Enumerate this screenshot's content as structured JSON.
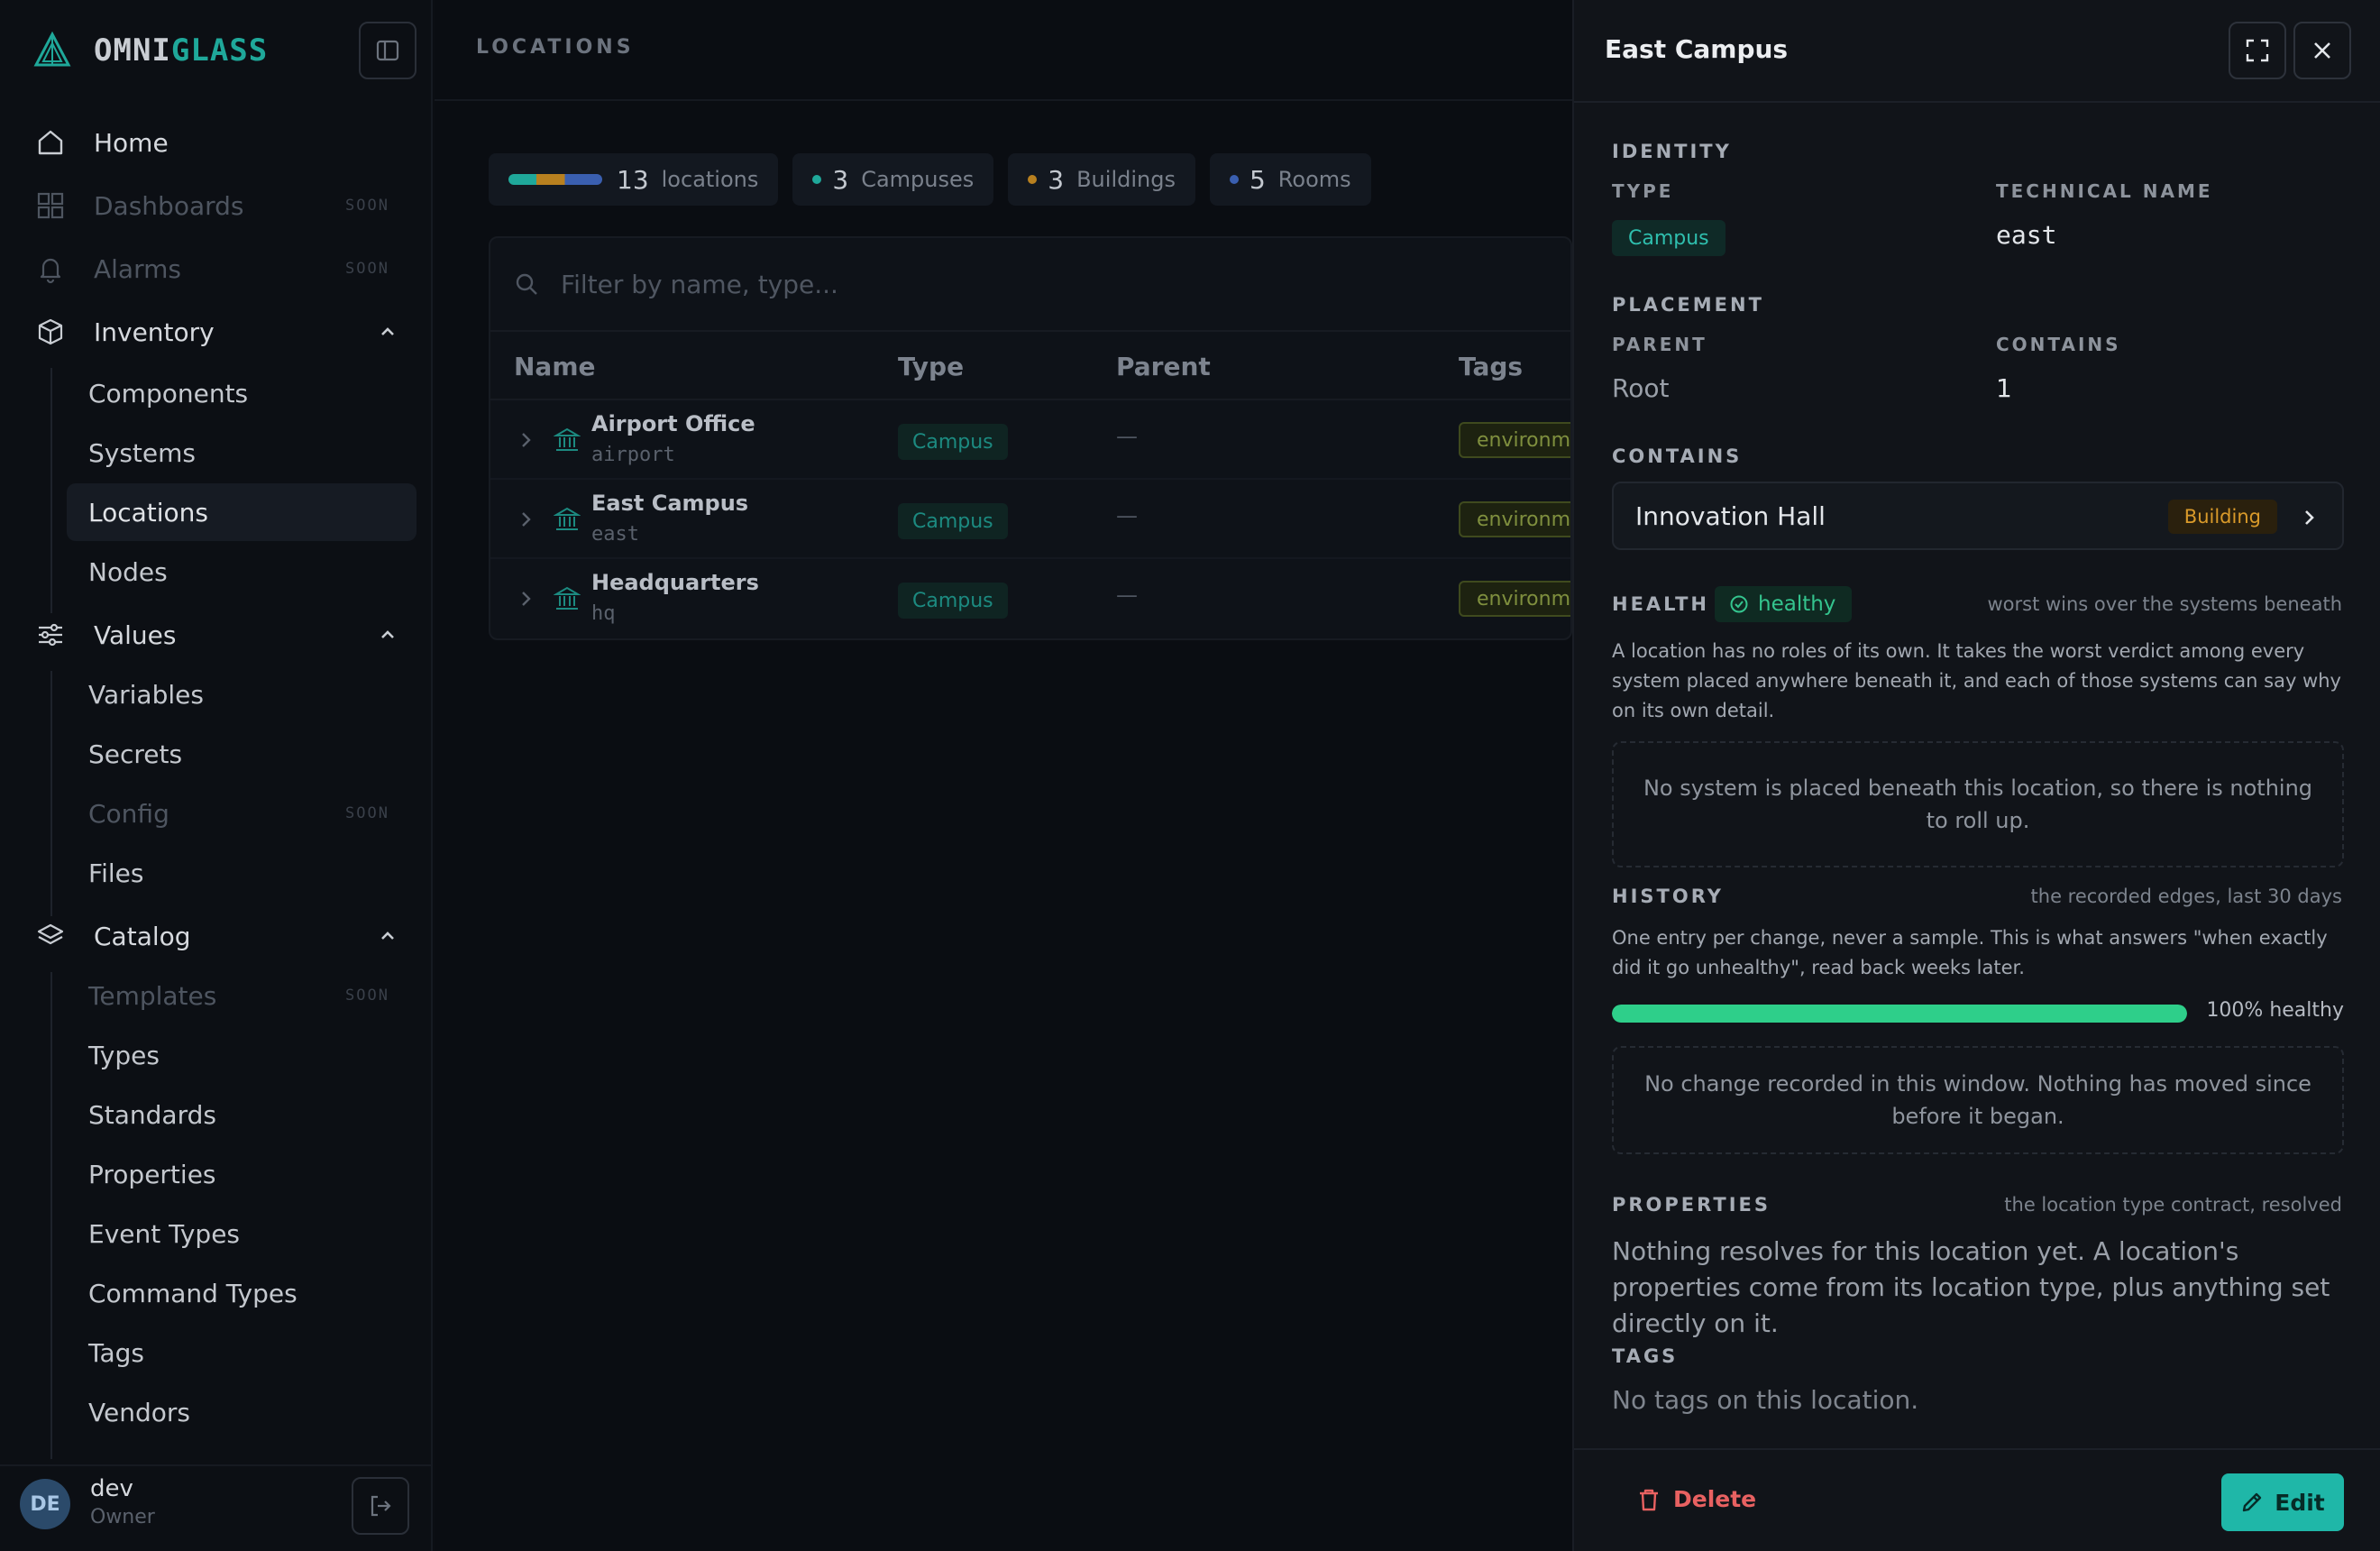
{
  "brand": {
    "part1": "OMNI",
    "part2": "GLASS"
  },
  "nav": {
    "home": "Home",
    "dashboards": "Dashboards",
    "alarms": "Alarms",
    "inventory": "Inventory",
    "components": "Components",
    "systems": "Systems",
    "locations": "Locations",
    "nodes": "Nodes",
    "values": "Values",
    "variables": "Variables",
    "secrets": "Secrets",
    "config": "Config",
    "files": "Files",
    "catalog": "Catalog",
    "templates": "Templates",
    "types": "Types",
    "standards": "Standards",
    "properties": "Properties",
    "event_types": "Event Types",
    "command_types": "Command Types",
    "tags": "Tags",
    "vendors": "Vendors",
    "soon": "SOON"
  },
  "user": {
    "initials": "DE",
    "name": "dev",
    "role": "Owner"
  },
  "main": {
    "title": "LOCATIONS",
    "stats": {
      "total_count": "13",
      "total_label": "locations",
      "campuses_count": "3",
      "campuses_label": "Campuses",
      "buildings_count": "3",
      "buildings_label": "Buildings",
      "rooms_count": "5",
      "rooms_label": "Rooms"
    },
    "filter_placeholder": "Filter by name, type...",
    "columns": {
      "name": "Name",
      "type": "Type",
      "parent": "Parent",
      "tags": "Tags"
    },
    "rows": [
      {
        "name": "Airport Office",
        "tech": "airport",
        "type": "Campus",
        "parent": "—",
        "tag": "environm"
      },
      {
        "name": "East Campus",
        "tech": "east",
        "type": "Campus",
        "parent": "—",
        "tag": "environm"
      },
      {
        "name": "Headquarters",
        "tech": "hq",
        "type": "Campus",
        "parent": "—",
        "tag": "environm"
      }
    ]
  },
  "panel": {
    "title": "East Campus",
    "identity_label": "IDENTITY",
    "type_label": "TYPE",
    "type_value": "Campus",
    "tech_label": "TECHNICAL NAME",
    "tech_value": "east",
    "placement_label": "PLACEMENT",
    "parent_label": "PARENT",
    "parent_value": "Root",
    "contains_count_label": "CONTAINS",
    "contains_count_value": "1",
    "contains_label": "CONTAINS",
    "contains_item_name": "Innovation Hall",
    "contains_item_type": "Building",
    "health_label": "HEALTH",
    "health_status": "healthy",
    "health_note": "worst wins over the systems beneath",
    "health_desc": "A location has no roles of its own. It takes the worst verdict among every system placed anywhere beneath it, and each of those systems can say why on its own detail.",
    "health_empty": "No system is placed beneath this location, so there is nothing to roll up.",
    "history_label": "HISTORY",
    "history_note": "the recorded edges, last 30 days",
    "history_desc": "One entry per change, never a sample. This is what answers \"when exactly did it go unhealthy\", read back weeks later.",
    "history_healthy_pct": 100,
    "history_progress_label": "100% healthy",
    "history_empty": "No change recorded in this window. Nothing has moved since before it began.",
    "properties_label": "PROPERTIES",
    "properties_note": "the location type contract, resolved",
    "properties_text": "Nothing resolves for this location yet. A location's properties come from its location type, plus anything set directly on it.",
    "tags_label": "TAGS",
    "tags_text": "No tags on this location.",
    "delete_label": "Delete",
    "edit_label": "Edit"
  },
  "colors": {
    "accent": "#1fb7a8",
    "campus": "#1fa89a",
    "building": "#d99a2a",
    "room": "#3a5fb0",
    "healthy": "#2ecf8a",
    "danger": "#e86161"
  },
  "icons": {
    "brand": "omniglass-logo-icon",
    "home": "home-icon",
    "dashboards": "grid-icon",
    "alarms": "bell-icon",
    "inventory": "box-icon",
    "values": "sliders-icon",
    "catalog": "layers-icon",
    "location": "building-columns-icon",
    "health": "check-circle-icon",
    "delete": "trash-icon",
    "edit": "pencil-icon"
  }
}
